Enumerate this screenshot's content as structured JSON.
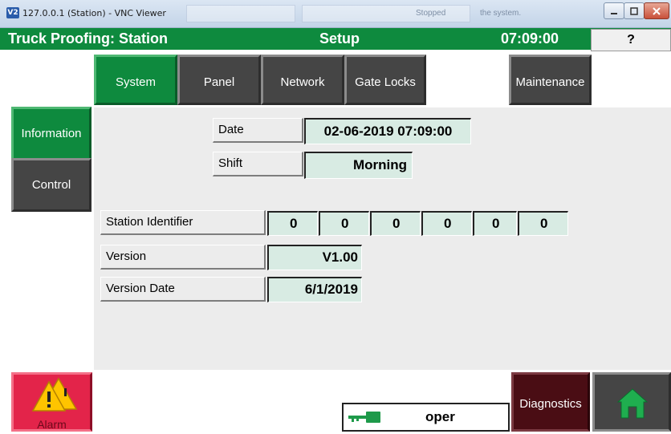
{
  "window": {
    "title": "127.0.0.1 (Station) - VNC Viewer",
    "app_icon": "V2",
    "ghost_texts": [
      "Stopped",
      "the system."
    ]
  },
  "header": {
    "title": "Truck Proofing: Station",
    "screen": "Setup",
    "time": "07:09:00",
    "help_label": "?"
  },
  "tabs": [
    {
      "label": "System",
      "active": true
    },
    {
      "label": "Panel",
      "active": false
    },
    {
      "label": "Network",
      "active": false
    },
    {
      "label": "Gate Locks",
      "active": false
    },
    {
      "label": "Maintenance",
      "active": false
    }
  ],
  "sidebar": [
    {
      "label": "Information",
      "active": true
    },
    {
      "label": "Control",
      "active": false
    }
  ],
  "fields": {
    "date": {
      "label": "Date",
      "value": "02-06-2019 07:09:00"
    },
    "shift": {
      "label": "Shift",
      "value": "Morning"
    },
    "station_identifier": {
      "label": "Station Identifier",
      "values": [
        "0",
        "0",
        "0",
        "0",
        "0",
        "0"
      ]
    },
    "version": {
      "label": "Version",
      "value": "V1.00"
    },
    "version_date": {
      "label": "Version Date",
      "value": "6/1/2019"
    }
  },
  "bottom": {
    "alarm_label": "Alarm",
    "operator_label": "oper",
    "diagnostics_label": "Diagnostics"
  },
  "colors": {
    "primary_green": "#0e8a3e",
    "dark_button": "#454545",
    "alarm_red": "#e3244a",
    "diagnostics_maroon": "#4a0d14",
    "value_bg": "#d8ebe3"
  },
  "icons": [
    "app-icon",
    "minimize-icon",
    "maximize-icon",
    "close-icon",
    "warning-icon",
    "key-icon",
    "home-icon"
  ]
}
